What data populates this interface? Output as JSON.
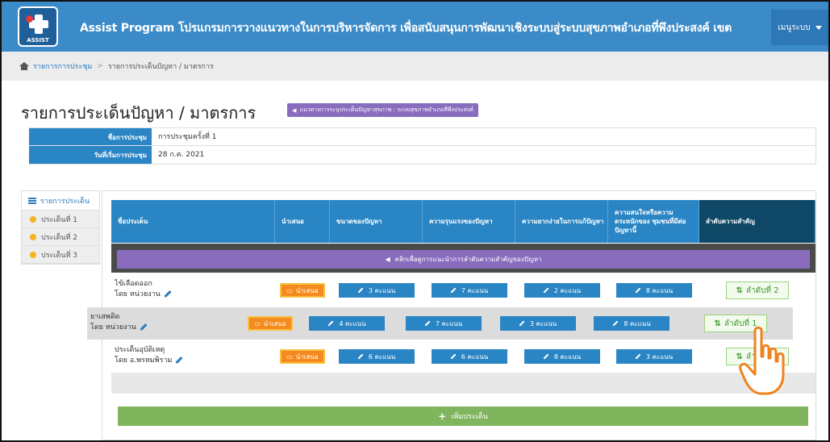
{
  "header": {
    "logo_text": "ASSIST",
    "title": "Assist Program โปรแกรมการวางแนวทางในการบริหารจัดการ เพื่อสนับสนุนการพัฒนาเชิงระบบสู่ระบบสุขภาพอำเภอที่พึงประสงค์ เขต",
    "menu_label": "เมนูระบบ"
  },
  "breadcrumb": {
    "home_link": "รายการการประชุม",
    "separator": ">",
    "current": "รายการประเด็นปัญหา / มาตรการ"
  },
  "page": {
    "title": "รายการประเด็นปัญหา / มาตรการ",
    "badge": "แนวทางการระบุประเด็นปัญหาสุขภาพ : ระบบสุขภาพอำเภอที่พึงประสงค์"
  },
  "info": {
    "meeting_name_label": "ชื่อการประชุม",
    "meeting_name_value": "การประชุมครั้งที่ 1",
    "start_date_label": "วันที่เริ่มการประชุม",
    "start_date_value": "28 ก.ค. 2021"
  },
  "sidebar": {
    "header": "รายการประเด็น",
    "items": [
      {
        "label": "ประเด็นที่ 1"
      },
      {
        "label": "ประเด็นที่ 2"
      },
      {
        "label": "ประเด็นที่ 3"
      }
    ]
  },
  "table": {
    "headers": {
      "name": "ชื่อประเด็น",
      "present": "นำเสนอ",
      "size": "ขนาดของปัญหา",
      "severity": "ความรุนแรงของปัญหา",
      "difficulty": "ความยากง่ายในการแก้ปัญหา",
      "concern": "ความสนใจหรือความตระหนักของ ชุมชนที่มีต่อปัญหานี้",
      "rank": "ลำดับความสำคัญ"
    },
    "banner": "คลิกเพื่อดูการแนะนำการลำดับความสำคัญของปัญหา",
    "present_label": "นำเสนอ",
    "rows": [
      {
        "name": "ไข้เลือดออก",
        "by": "โดย หน่วยงาน",
        "size": "3 คะแนน",
        "severity": "7 คะแนน",
        "difficulty": "2 คะแนน",
        "concern": "8 คะแนน",
        "rank": "ลำดับที่ 2"
      },
      {
        "name": "ยาเสพติด",
        "by": "โดย หน่วยงาน",
        "size": "4 คะแนน",
        "severity": "7 คะแนน",
        "difficulty": "3 คะแนน",
        "concern": "8 คะแนน",
        "rank": "ลำดับที่ 1"
      },
      {
        "name": "ประเด็นอุบัติเหตุ",
        "by": "โดย อ.พรหมพิราม",
        "size": "6 คะแนน",
        "severity": "6 คะแนน",
        "difficulty": "8 คะแนน",
        "concern": "3 คะแนน",
        "rank": "ลำดับที่ 3"
      }
    ],
    "add_label": "เพิ่มประเด็น"
  }
}
